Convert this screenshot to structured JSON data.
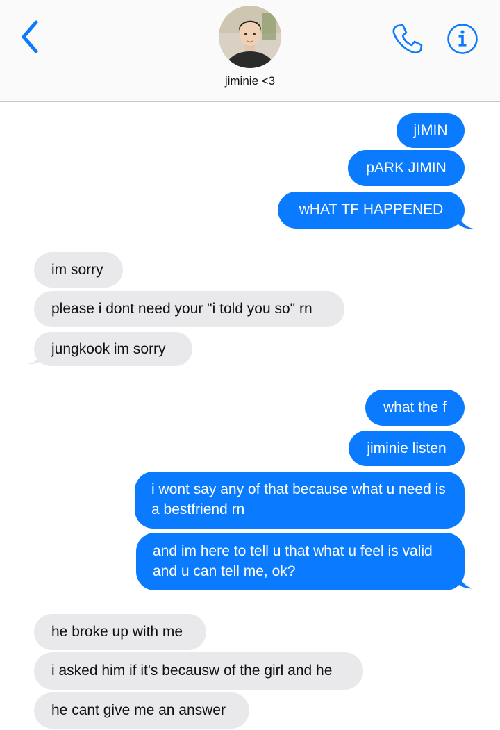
{
  "header": {
    "contact_name": "jiminie <3",
    "back_icon": "chevron-left-icon",
    "call_icon": "phone-icon",
    "info_icon": "info-icon",
    "accent_color": "#0a7bfe"
  },
  "messages": [
    {
      "from": "me",
      "text": "jIMIN"
    },
    {
      "from": "me",
      "text": "pARK JIMIN"
    },
    {
      "from": "me",
      "text": "wHAT TF HAPPENED"
    },
    {
      "from": "them",
      "text": "im sorry"
    },
    {
      "from": "them",
      "text": "please i dont need your \"i told you so\" rn"
    },
    {
      "from": "them",
      "text": "jungkook im sorry"
    },
    {
      "from": "me",
      "text": "what the f"
    },
    {
      "from": "me",
      "text": "jiminie listen"
    },
    {
      "from": "me",
      "text": "i wont say any of that because what u need is a bestfriend rn"
    },
    {
      "from": "me",
      "text": "and im here to tell u that what u feel is valid and u can tell me, ok?"
    },
    {
      "from": "them",
      "text": "he broke up with me"
    },
    {
      "from": "them",
      "text": "i asked him if it's becausw of the girl and he"
    },
    {
      "from": "them",
      "text": "he cant give me an answer"
    }
  ],
  "colors": {
    "sent_bubble": "#0a7bfe",
    "received_bubble": "#e9e9eb"
  }
}
